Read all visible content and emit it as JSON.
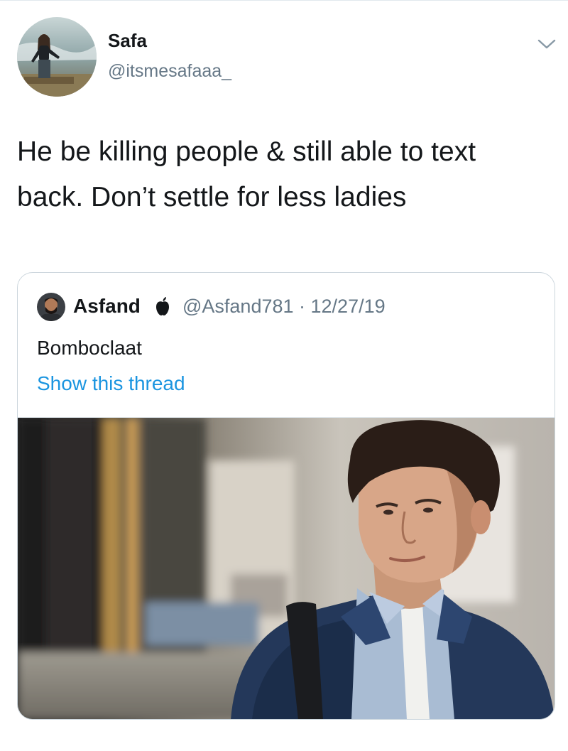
{
  "tweet": {
    "author_name": "Safa",
    "author_handle": "@itsmesafaaa_",
    "text": "He be killing people & still able to text\nback. Don’t settle for less ladies",
    "icons": {
      "avatar": "profile-photo",
      "menu": "chevron-down-icon"
    }
  },
  "quote": {
    "author_name": "Asfand",
    "badge_icon": "apple-logo-icon",
    "author_handle": "@Asfand781",
    "separator": " · ",
    "date": "12/27/19",
    "text": "Bomboclaat",
    "show_thread": "Show this thread",
    "link_color": "#1b95e0"
  },
  "colors": {
    "text_primary": "#14171a",
    "text_secondary": "#657786",
    "border": "#ccd6dd"
  }
}
